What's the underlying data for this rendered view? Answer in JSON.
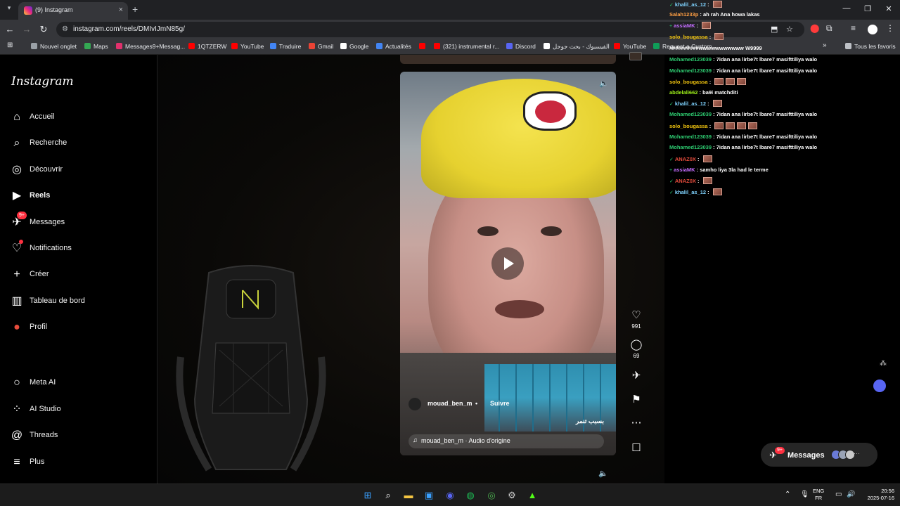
{
  "browser": {
    "tab_title": "(9) Instagram",
    "url": "instagram.com/reels/DMIvIJmN85g/",
    "bookmarks": [
      {
        "label": "Nouvel onglet",
        "color": "#9aa0a6"
      },
      {
        "label": "Maps",
        "color": "#34a853"
      },
      {
        "label": "Messages9+Messag...",
        "color": "#e1306c"
      },
      {
        "label": "1QTZERW",
        "color": "#ff0000"
      },
      {
        "label": "YouTube",
        "color": "#ff0000"
      },
      {
        "label": "Traduire",
        "color": "#4285f4"
      },
      {
        "label": "Gmail",
        "color": "#ea4335"
      },
      {
        "label": "Google",
        "color": "#ffffff"
      },
      {
        "label": "Actualités",
        "color": "#4285f4"
      },
      {
        "label": "",
        "color": "#ff0000"
      },
      {
        "label": "(321) instrumental r...",
        "color": "#ff0000"
      },
      {
        "label": "Discord",
        "color": "#5865f2"
      },
      {
        "label": "الفيسبوك - بحث جوجل",
        "color": "#ffffff"
      },
      {
        "label": "YouTube",
        "color": "#ff0000"
      },
      {
        "label": "Request a Custom...",
        "color": "#0f9d58"
      }
    ],
    "all_bookmarks": "Tous les favoris"
  },
  "instagram": {
    "logo": "Instagram",
    "nav": [
      {
        "label": "Accueil",
        "icon": "⌂"
      },
      {
        "label": "Recherche",
        "icon": "⌕"
      },
      {
        "label": "Découvrir",
        "icon": "◎"
      },
      {
        "label": "Reels",
        "icon": "▶"
      },
      {
        "label": "Messages",
        "icon": "✈",
        "badge": "9+"
      },
      {
        "label": "Notifications",
        "icon": "♡"
      },
      {
        "label": "Créer",
        "icon": "+"
      },
      {
        "label": "Tableau de bord",
        "icon": "▥"
      },
      {
        "label": "Profil",
        "icon": "●"
      }
    ],
    "nav_bottom": [
      {
        "label": "Meta AI",
        "icon": "○"
      },
      {
        "label": "AI Studio",
        "icon": "⁘"
      },
      {
        "label": "Threads",
        "icon": "@"
      },
      {
        "label": "Plus",
        "icon": "≡"
      }
    ]
  },
  "reel": {
    "author": "mouad_ben_m",
    "separator": "•",
    "follow": "Suivre",
    "audio": "mouad_ben_m · Audio d'origine",
    "inset_caption": "بسبب تنمر",
    "likes": "991",
    "comments": "69"
  },
  "chat": [
    {
      "user": "khalil_as_12",
      "color": "#7fd3ff",
      "text": "",
      "emotes": 1,
      "badge": "✓"
    },
    {
      "user": "Salah1233p",
      "color": "#ff9f43",
      "text": "ah rah Ana howa lakas",
      "emotes": 0
    },
    {
      "user": "assiaMK",
      "color": "#c46dff",
      "text": "",
      "emotes": 1,
      "badge": "+"
    },
    {
      "user": "solo_bougassa",
      "color": "#f1c40f",
      "text": "",
      "emotes": 1
    },
    {
      "user": "",
      "color": "#ffffff",
      "text": "##########wwwwwwwwwww W9999",
      "emotes": 0
    },
    {
      "user": "Mohamed123039",
      "color": "#2ecc71",
      "text": "7idan ana lirbe7t lbare7 masifttiliya walo",
      "emotes": 0
    },
    {
      "user": "Mohamed123039",
      "color": "#2ecc71",
      "text": "7idan ana lirbe7t lbare7 masifttiliya walo",
      "emotes": 0
    },
    {
      "user": "solo_bougassa",
      "color": "#f1c40f",
      "text": "",
      "emotes": 3
    },
    {
      "user": "abdelali662",
      "color": "#9ef01a",
      "text": "ba9i matchditi",
      "emotes": 0
    },
    {
      "user": "khalil_as_12",
      "color": "#7fd3ff",
      "text": "",
      "emotes": 1,
      "badge": "✓"
    },
    {
      "user": "Mohamed123039",
      "color": "#2ecc71",
      "text": "7idan ana lirbe7t lbare7 masifttiliya walo",
      "emotes": 0
    },
    {
      "user": "solo_bougassa",
      "color": "#f1c40f",
      "text": "",
      "emotes": 4
    },
    {
      "user": "Mohamed123039",
      "color": "#2ecc71",
      "text": "7idan ana lirbe7t lbare7 masifttiliya walo",
      "emotes": 0
    },
    {
      "user": "Mohamed123039",
      "color": "#2ecc71",
      "text": "7idan ana lirbe7t lbare7 masifttiliya walo",
      "emotes": 0
    },
    {
      "user": "ANAZ0X",
      "color": "#e74c3c",
      "text": "",
      "emotes": 1,
      "badge": "✓"
    },
    {
      "user": "assiaMK",
      "color": "#c46dff",
      "text": "samho liya 3la had le terme",
      "emotes": 0,
      "badge": "+"
    },
    {
      "user": "ANAZ0X",
      "color": "#e74c3c",
      "text": "",
      "emotes": 1,
      "badge": "✓"
    },
    {
      "user": "khalil_as_12",
      "color": "#7fd3ff",
      "text": "",
      "emotes": 1,
      "badge": "✓"
    }
  ],
  "messages_bar": {
    "label": "Messages",
    "badge": "9+"
  },
  "taskbar": {
    "lang_top": "ENG",
    "lang_bottom": "FR",
    "time": "20:56",
    "date": "2025-07-16"
  }
}
